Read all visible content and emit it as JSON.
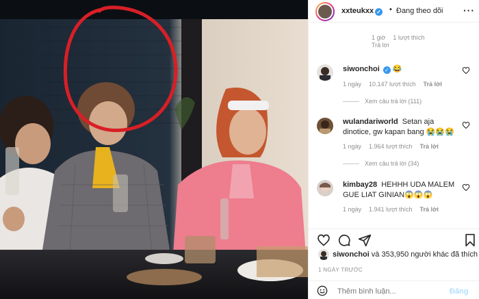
{
  "colors": {
    "accent": "#3897f0",
    "muted": "#8e8e8e",
    "post_disabled": "#b2dffc",
    "annotation_circle": "#d81f26"
  },
  "header": {
    "username": "xxteukxx",
    "separator": "•",
    "follow_status": "Đang theo dõi",
    "more_icon": "more-horizontal-icon"
  },
  "previous_comment": {
    "time": "1 giờ",
    "likes": "1 lượt thích",
    "reply": "Trả lời"
  },
  "comments": [
    {
      "username": "siwonchoi",
      "verified": true,
      "text": "😂",
      "time": "1 ngày",
      "likes": "10.147 lượt thích",
      "reply": "Trả lời",
      "view_replies": "Xem câu trả lời (111)"
    },
    {
      "username": "wulandariworld",
      "verified": false,
      "text": "Setan aja dinotice, gw kapan bang 😭😭😭",
      "time": "1 ngày",
      "likes": "1.964 lượt thích",
      "reply": "Trả lời",
      "view_replies": "Xem câu trả lời (34)"
    },
    {
      "username": "kimbay28",
      "verified": false,
      "text": "HEHHH UDA MALEM GUE LIAT GINIAN😱😱😱",
      "time": "1 ngày",
      "likes": "1.941 lượt thích",
      "reply": "Trả lời"
    }
  ],
  "actions": {
    "like_icon": "heart-icon",
    "comment_icon": "comment-icon",
    "share_icon": "share-icon",
    "save_icon": "bookmark-icon"
  },
  "liked_by": {
    "user": "siwonchoi",
    "rest": "và 353,950 người khác đã thích"
  },
  "post_time": "1 NGÀY TRƯỚC",
  "add_comment": {
    "placeholder": "Thêm bình luận...",
    "post_label": "Đăng"
  }
}
